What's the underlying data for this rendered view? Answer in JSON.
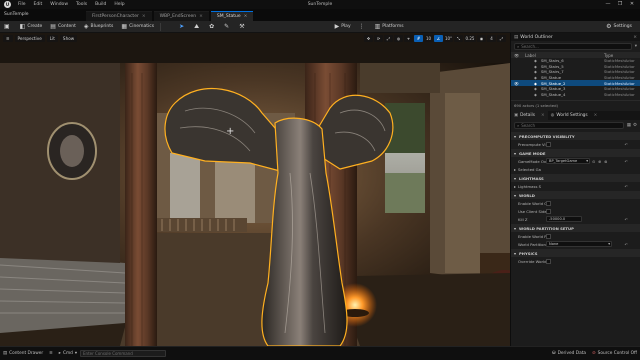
{
  "menubar": {
    "items": [
      "File",
      "Edit",
      "Window",
      "Tools",
      "Build",
      "Help"
    ],
    "title": "SunTemple",
    "window_controls": [
      "—",
      "❐",
      "✕"
    ]
  },
  "tabs": {
    "level": "SunTemple",
    "items": [
      "FirstPersonCharacter",
      "WBP_EndScreen",
      "SM_Statue"
    ],
    "active_index": 2
  },
  "toolbar": {
    "save": "",
    "create": "Create",
    "content": "Content",
    "blueprints": "Blueprints",
    "cinematics": "Cinematics",
    "play": "Play",
    "platforms": "Platforms",
    "settings": "Settings"
  },
  "viewport": {
    "menu": "≡",
    "perspective": "Perspective",
    "lit": "Lit",
    "show": "Show",
    "grid_snap": "10",
    "rot_snap": "10°",
    "scale_snap": "0.25",
    "camera_speed": "4",
    "crosshair": "+"
  },
  "outliner": {
    "title": "World Outliner",
    "search_placeholder": "Search...",
    "col_label": "Label",
    "col_type": "Type",
    "rows": [
      {
        "name": "SM_Stairs_6",
        "type": "StaticMeshActor",
        "selected": false
      },
      {
        "name": "SM_Stairs_5",
        "type": "StaticMeshActor",
        "selected": false
      },
      {
        "name": "SM_Stairs_7",
        "type": "StaticMeshActor",
        "selected": false
      },
      {
        "name": "SM_Statue",
        "type": "StaticMeshActor",
        "selected": false
      },
      {
        "name": "SM_Statue_2",
        "type": "StaticMeshActor",
        "selected": true
      },
      {
        "name": "SM_Statue_3",
        "type": "StaticMeshActor",
        "selected": false
      },
      {
        "name": "SM_Statue_4",
        "type": "StaticMeshActor",
        "selected": false
      }
    ],
    "actor_count": "690 actors (1 selected)"
  },
  "details": {
    "tab_details": "Details",
    "tab_world": "World Settings",
    "search_placeholder": "Search",
    "sections": {
      "precomputed": "PRECOMPUTED VISIBILITY",
      "gamemode": "GAME MODE",
      "lightmass": "LIGHTMASS",
      "world": "WORLD",
      "partition": "WORLD PARTITION SETUP",
      "physics": "PHYSICS"
    },
    "props": {
      "precompute_vis": "Precompute Vi",
      "gamemode_override": "GameMode Ov",
      "gamemode_value": "BP_TargetGame",
      "selected_gm": "Selected Ga",
      "lightmass_settings": "Lightmass S",
      "enable_world": "Enable World C",
      "use_client": "Use Client Side",
      "kill_z": "Kill Z",
      "kill_z_value": "-50000.0",
      "enable_partition": "Enable World P",
      "world_partition": "World Partition",
      "world_partition_value": "None",
      "override_world": "Override World"
    }
  },
  "statusbar": {
    "content_drawer": "Content Drawer",
    "cmd": "Cmd",
    "console_placeholder": "Enter Console Command",
    "derived_data": "Derived Data",
    "source_control": "Source Control Off"
  }
}
